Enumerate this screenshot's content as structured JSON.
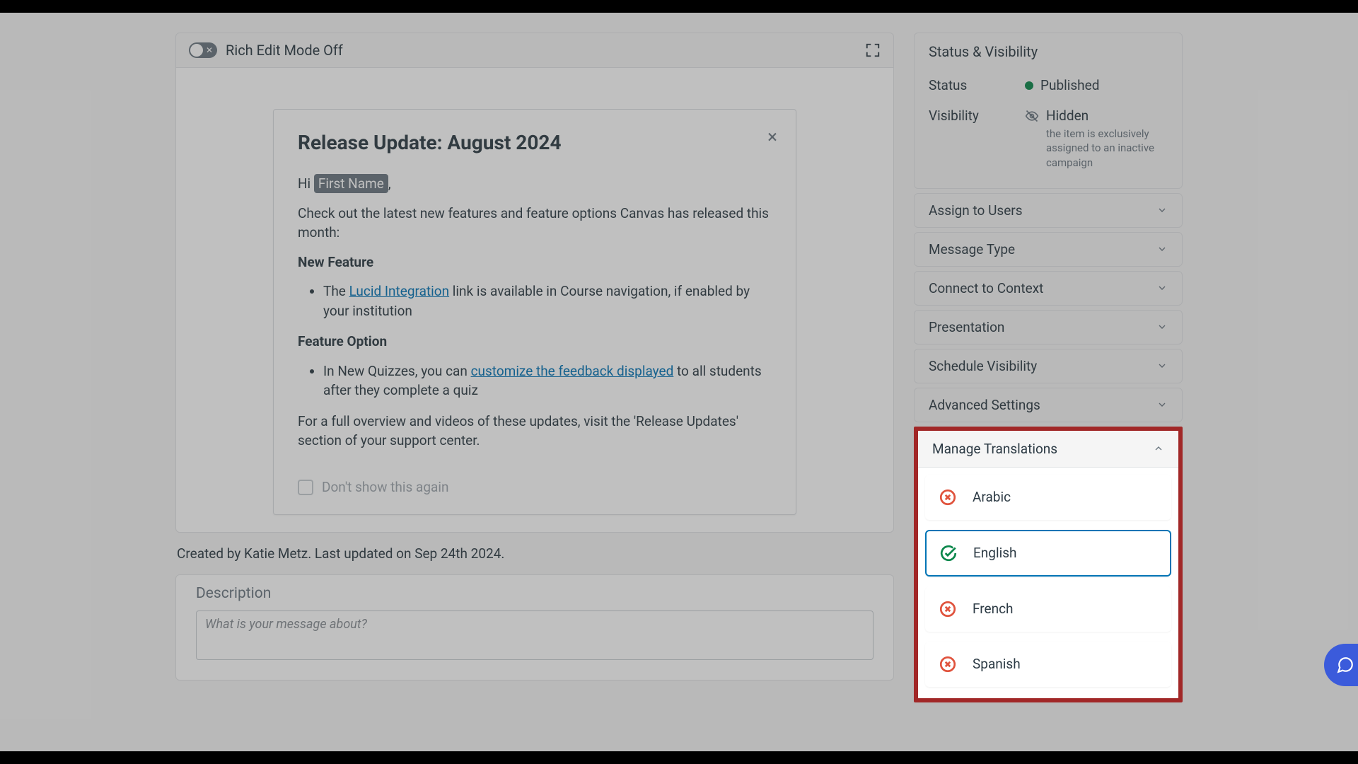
{
  "toolbar": {
    "rich_edit_label": "Rich Edit Mode Off"
  },
  "card": {
    "title": "Release Update: August 2024",
    "greeting_pre": "Hi ",
    "merge_field": "First Name",
    "greeting_post": ",",
    "intro": "Check out the latest new features and feature options Canvas has released this month:",
    "section1": "New Feature",
    "bullet1_pre": "The ",
    "bullet1_link": "Lucid Integration",
    "bullet1_post": " link is available in Course navigation, if enabled by your institution",
    "section2": "Feature Option",
    "bullet2_pre": "In New Quizzes, you can ",
    "bullet2_link": "customize the feedback displayed",
    "bullet2_post": " to all students after they complete a quiz",
    "outro": "For a full overview and videos of these updates, visit the 'Release Updates' section of your support center.",
    "dont_show": "Don't show this again"
  },
  "meta": "Created by Katie Metz. Last updated on Sep 24th 2024.",
  "description": {
    "label": "Description",
    "placeholder": "What is your message about?"
  },
  "sidebar": {
    "status_header": "Status & Visibility",
    "status_label": "Status",
    "status_value": "Published",
    "visibility_label": "Visibility",
    "visibility_value": "Hidden",
    "visibility_sub": "the item is exclusively assigned to an inactive campaign",
    "accordions": [
      "Assign to Users",
      "Message Type",
      "Connect to Context",
      "Presentation",
      "Schedule Visibility",
      "Advanced Settings"
    ],
    "translations_header": "Manage Translations",
    "translations": [
      {
        "name": "Arabic",
        "state": "error"
      },
      {
        "name": "English",
        "state": "ok",
        "selected": true
      },
      {
        "name": "French",
        "state": "error"
      },
      {
        "name": "Spanish",
        "state": "error"
      }
    ]
  }
}
